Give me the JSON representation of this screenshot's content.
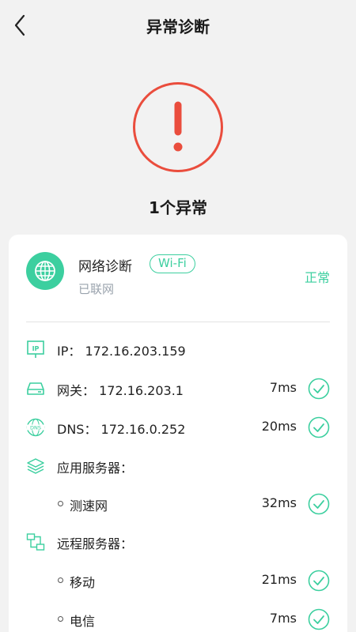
{
  "header": {
    "title": "异常诊断"
  },
  "alert": {
    "count_text": "1个异常"
  },
  "network": {
    "title": "网络诊断",
    "badge": "Wi-Fi",
    "subtitle": "已联网",
    "status": "正常"
  },
  "rows": {
    "ip": {
      "label": "IP： 172.16.203.159"
    },
    "gateway": {
      "label": "网关： 172.16.203.1",
      "latency": "7ms"
    },
    "dns": {
      "label": "DNS： 172.16.0.252",
      "latency": "20ms"
    },
    "app_server": {
      "label": "应用服务器："
    },
    "speedtest": {
      "label": "测速网",
      "latency": "32ms"
    },
    "remote_server": {
      "label": "远程服务器："
    },
    "mobile": {
      "label": "移动",
      "latency": "21ms"
    },
    "telecom": {
      "label": "电信",
      "latency": "7ms"
    }
  },
  "colors": {
    "accent": "#3ccf9f",
    "alert": "#ea4d3d",
    "background": "#f2f2f2"
  },
  "icons": {
    "back": "chevron-left-icon",
    "alert": "exclamation-icon",
    "network": "globe-icon",
    "ip": "ip-icon",
    "gateway": "router-icon",
    "dns": "dns-icon",
    "app_server": "layers-icon",
    "remote_server": "remote-network-icon",
    "check": "check-circle-icon"
  }
}
